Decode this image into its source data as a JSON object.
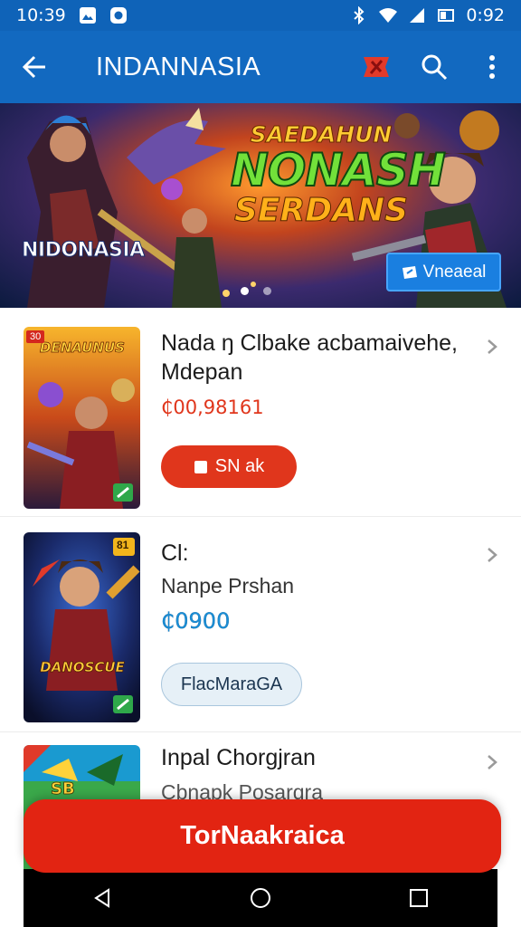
{
  "status_bar": {
    "time": "10:39",
    "battery_time": "0:92"
  },
  "app_bar": {
    "title": "INDANNASIA"
  },
  "banner": {
    "title_top": "SAEDAHUN",
    "title_mid": "NONASH",
    "title_bot": "SERDANS",
    "logo_text": "NIDONASIA",
    "button_label": "Vneaeal",
    "slide_count": 2,
    "active_slide": 1
  },
  "items": [
    {
      "title": "Nada ŋ Clbake acbamaivehe, Mdepan",
      "price": "₵00,98161",
      "button_label": "SN ak",
      "thumb_title": "DENAUNUS",
      "thumb_badge": "30"
    },
    {
      "title": "Cl:",
      "subtitle": "Nanpe Prshan",
      "price": "₵0900",
      "button_label": "FlacMaraGA",
      "thumb_title": "DANOSCUE",
      "thumb_badge": "81"
    },
    {
      "title": "Inpal Chorgjran",
      "subtitle": "Cbnapk Posarqra",
      "thumb_title": "SB"
    }
  ],
  "cta": {
    "label": "TorNaakraica"
  },
  "colors": {
    "app_bar": "#1269c0",
    "accent_red": "#e22412",
    "price_red": "#e0361c",
    "price_blue": "#1a8fd6"
  }
}
